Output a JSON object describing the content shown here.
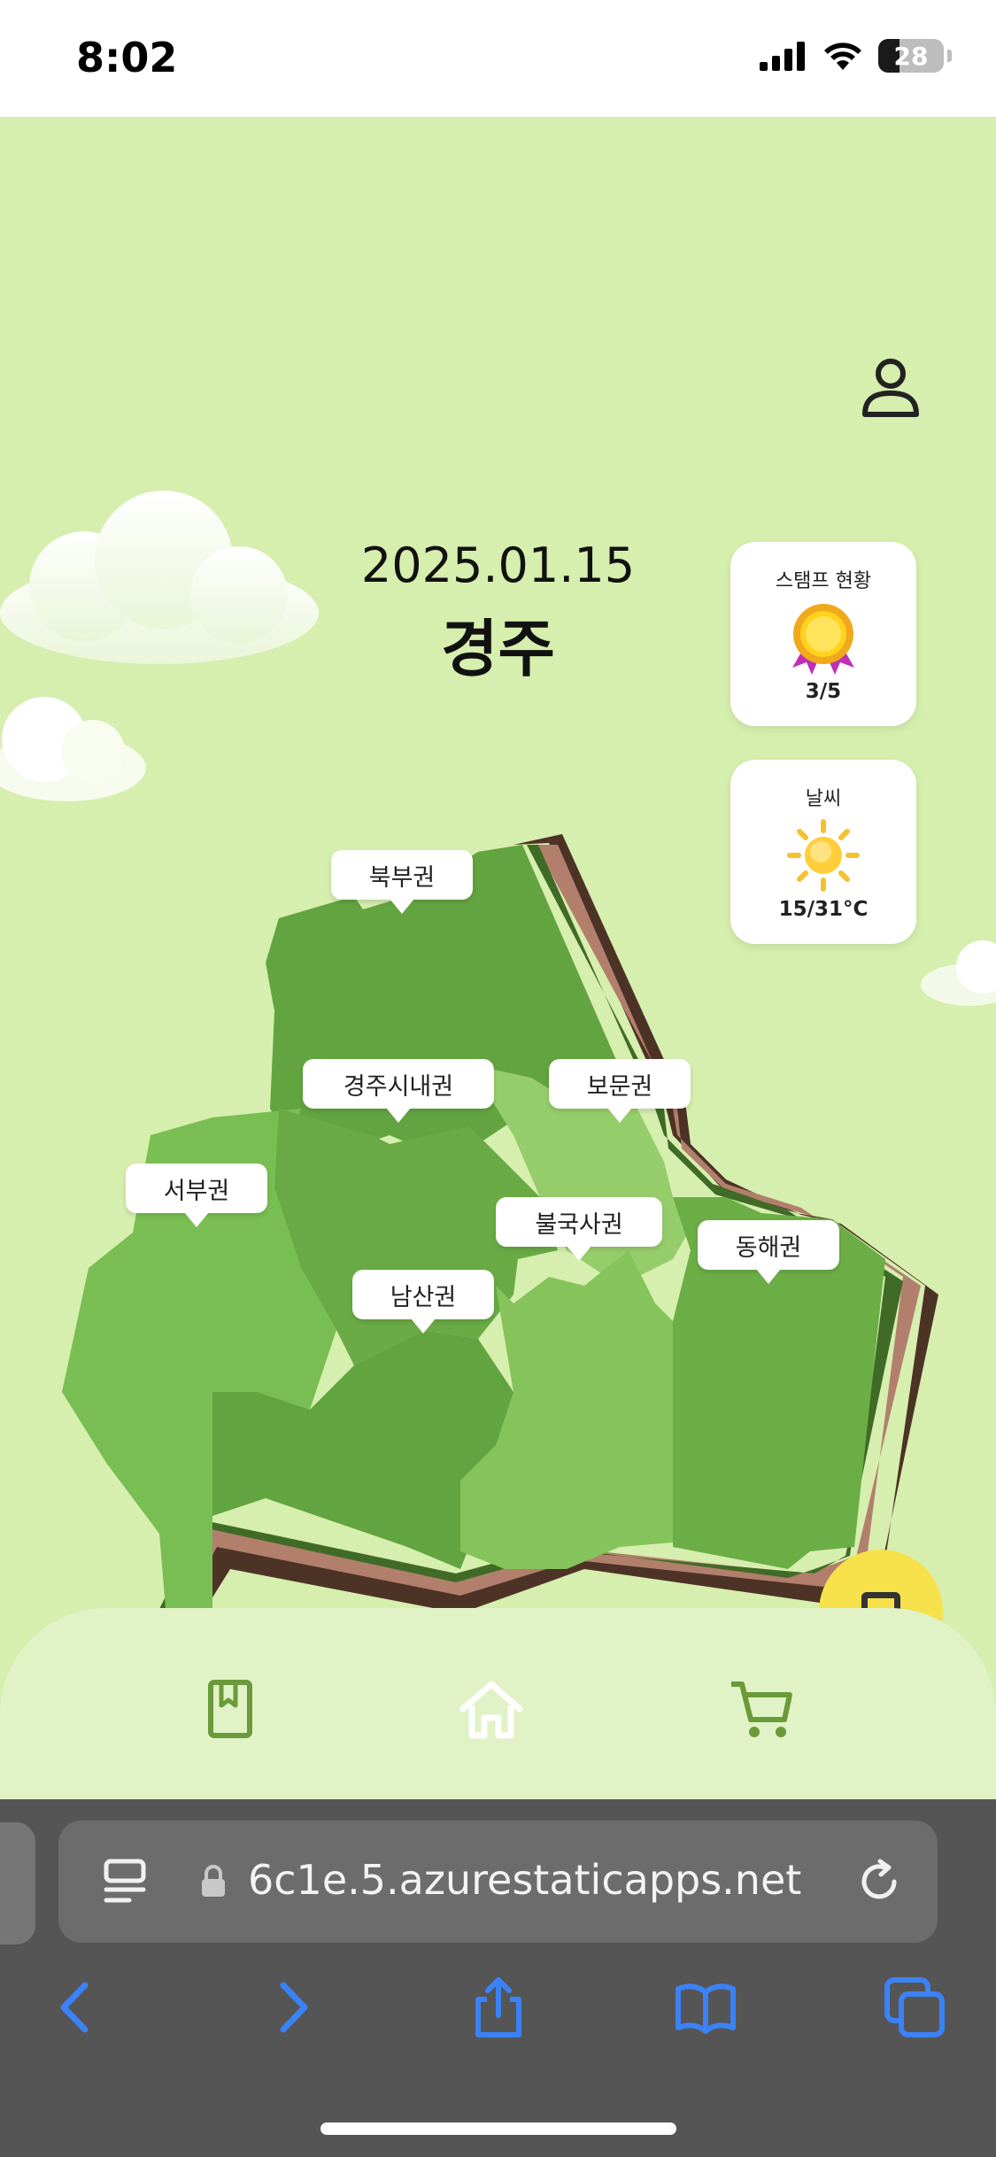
{
  "status_bar": {
    "time": "8:02",
    "battery": "28"
  },
  "header": {
    "date": "2025.01.15",
    "city": "경주"
  },
  "stamp_card": {
    "title": "스탬프 현황",
    "value": "3/5",
    "icon": "medal-icon"
  },
  "weather_card": {
    "title": "날씨",
    "value": "15/31°C",
    "icon": "sun-icon"
  },
  "regions": [
    {
      "label": "북부권"
    },
    {
      "label": "경주시내권"
    },
    {
      "label": "보문권"
    },
    {
      "label": "서부권"
    },
    {
      "label": "불국사권"
    },
    {
      "label": "남산권"
    },
    {
      "label": "동해권"
    }
  ],
  "bottom_nav": {
    "items": [
      {
        "icon": "bookmark-book-icon"
      },
      {
        "icon": "home-icon"
      },
      {
        "icon": "cart-icon"
      }
    ]
  },
  "browser": {
    "url": "6c1e.5.azurestaticapps.net"
  },
  "colors": {
    "background": "#d6eeae",
    "map_green_dark": "#5f9e3d",
    "map_green_light": "#93c96a",
    "map_edge_brown": "#b08070",
    "accent_yellow": "#f6e14a"
  }
}
